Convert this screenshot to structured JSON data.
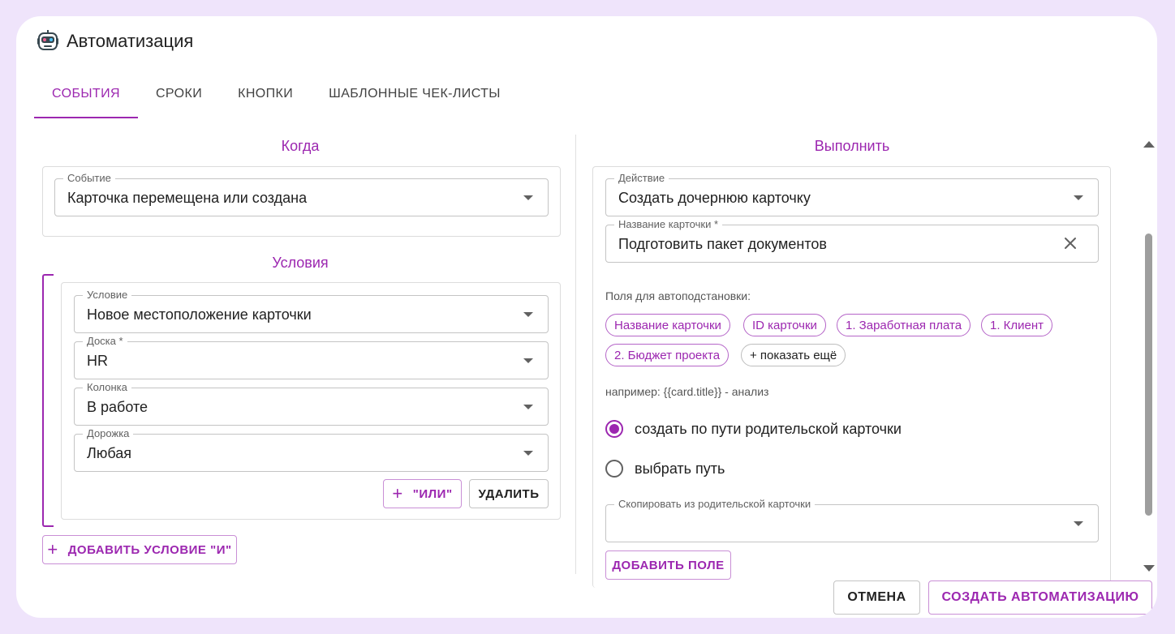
{
  "window": {
    "title": "Автоматизация",
    "icon": "robot-icon"
  },
  "tabs": [
    {
      "label": "СОБЫТИЯ",
      "active": true
    },
    {
      "label": "СРОКИ",
      "active": false
    },
    {
      "label": "КНОПКИ",
      "active": false
    },
    {
      "label": "ШАБЛОННЫЕ ЧЕК-ЛИСТЫ",
      "active": false
    }
  ],
  "when": {
    "title": "Когда",
    "event": {
      "label": "Событие",
      "value": "Карточка перемещена или создана"
    }
  },
  "conditions": {
    "title": "Условия",
    "condition": {
      "label": "Условие",
      "value": "Новое местоположение карточки"
    },
    "board": {
      "label": "Доска *",
      "value": "HR"
    },
    "column": {
      "label": "Колонка",
      "value": "В работе"
    },
    "lane": {
      "label": "Дорожка",
      "value": "Любая"
    },
    "or_button": "\"ИЛИ\"",
    "delete_button": "УДАЛИТЬ",
    "add_and_button": "ДОБАВИТЬ УСЛОВИЕ \"И\""
  },
  "execute": {
    "title": "Выполнить",
    "action": {
      "label": "Действие",
      "value": "Создать дочернюю карточку"
    },
    "card_name": {
      "label": "Название карточки *",
      "value": "Подготовить пакет документов"
    },
    "autofill_label": "Поля для автоподстановки:",
    "chips": [
      "Название карточки",
      "ID карточки",
      "1. Заработная плата",
      "1. Клиент",
      "2. Бюджет проекта"
    ],
    "show_more": "+ показать ещё",
    "example": "например: {{card.title}} - анализ",
    "radio_parent_path": "создать по пути родительской карточки",
    "radio_choose_path": "выбрать путь",
    "copy_from_parent": {
      "label": "Скопировать из родительской карточки",
      "value": ""
    },
    "add_field_button": "ДОБАВИТЬ ПОЛЕ"
  },
  "footer": {
    "cancel": "ОТМЕНА",
    "create": "СОЗДАТЬ АВТОМАТИЗАЦИЮ"
  },
  "colors": {
    "accent": "#9c27b0",
    "background": "#efe4fb"
  }
}
